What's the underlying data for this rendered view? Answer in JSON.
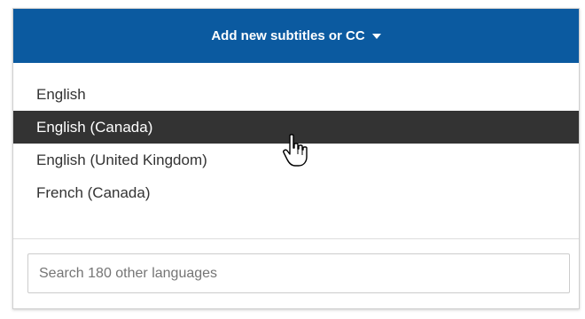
{
  "header": {
    "label": "Add new subtitles or CC",
    "caret_icon": "caret-down-icon"
  },
  "languages": [
    {
      "label": "English",
      "selected": false
    },
    {
      "label": "English (Canada)",
      "selected": true
    },
    {
      "label": "English (United Kingdom)",
      "selected": false
    },
    {
      "label": "French (Canada)",
      "selected": false
    }
  ],
  "search": {
    "placeholder": "Search 180 other languages",
    "value": ""
  },
  "cursor": {
    "icon": "hand-pointer-icon"
  },
  "colors": {
    "header_bg": "#0b5aa0",
    "selected_bg": "#333333"
  }
}
